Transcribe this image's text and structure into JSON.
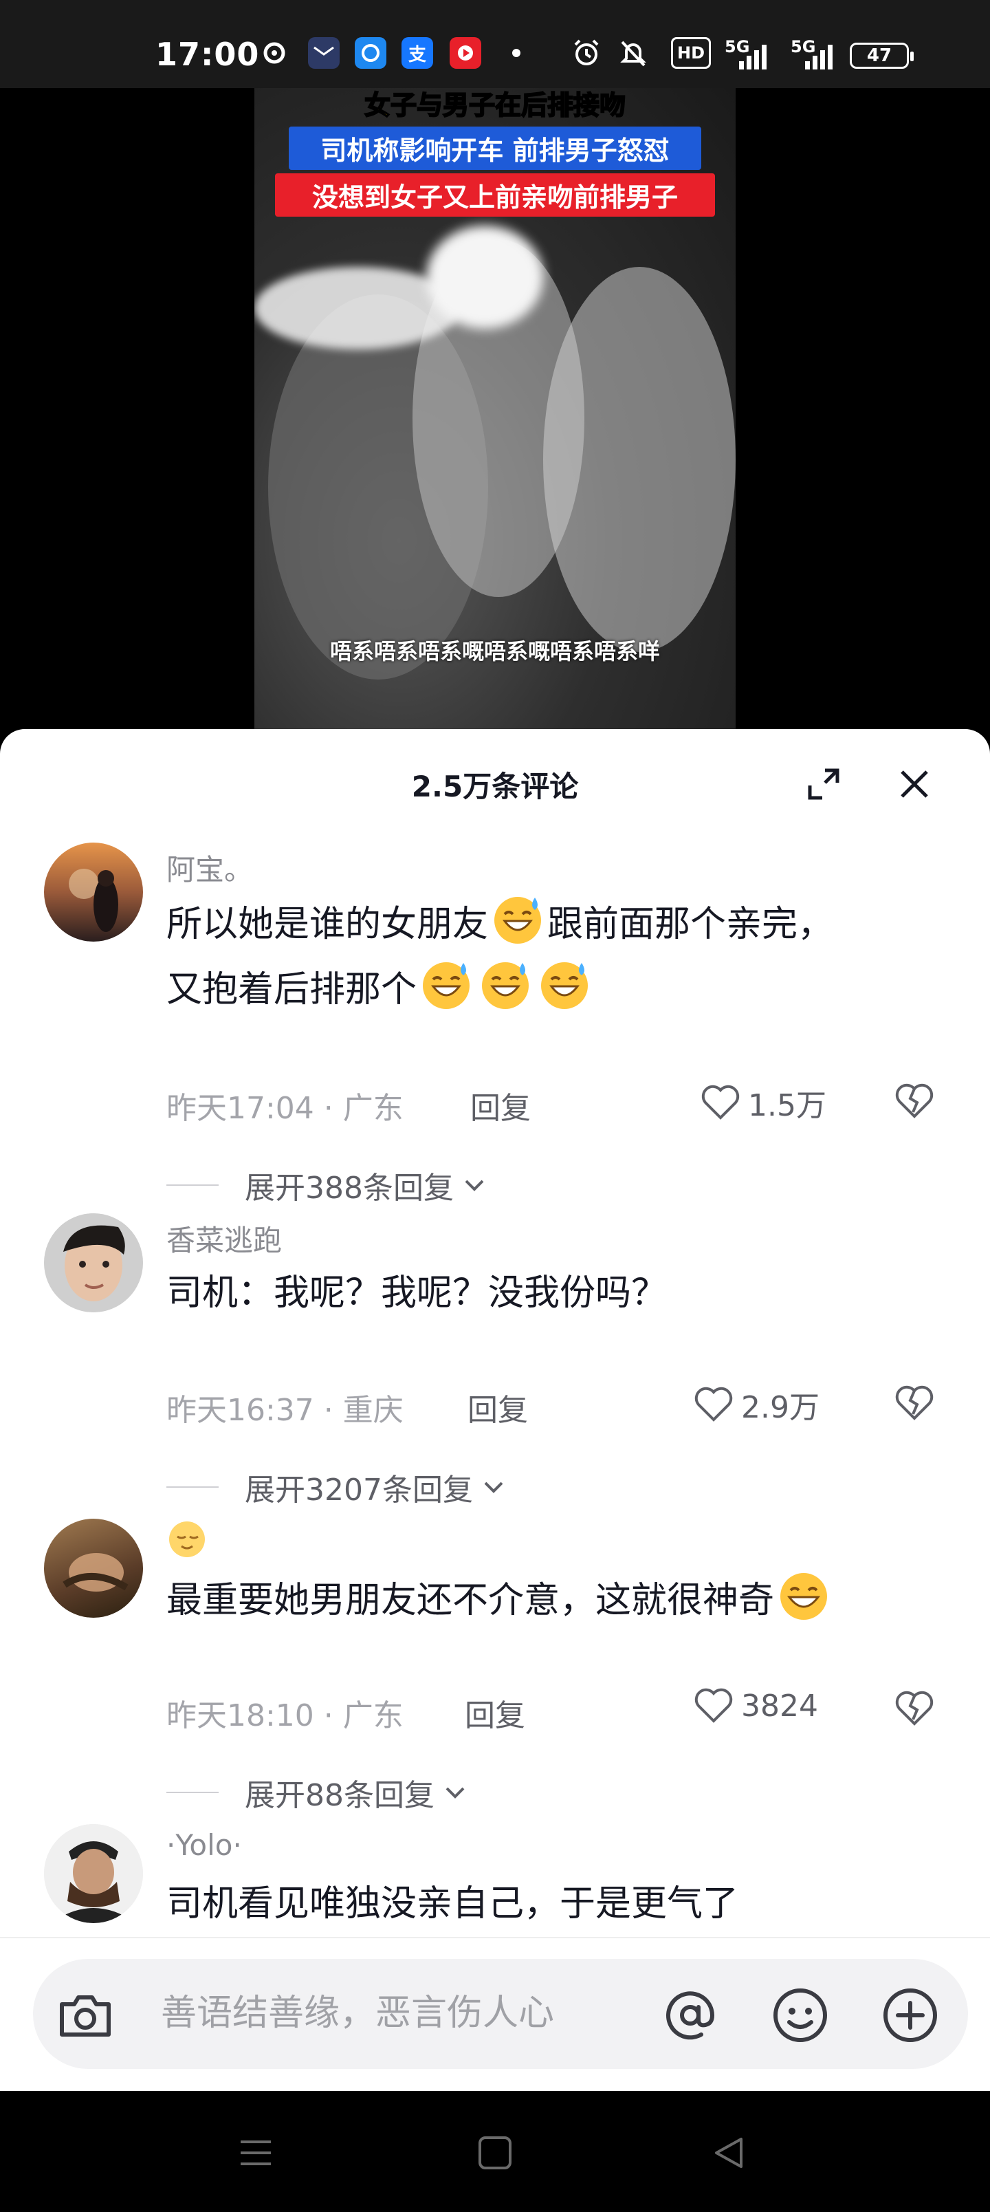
{
  "status_bar": {
    "time": "17:00",
    "hd_label": "HD",
    "net1": "5G",
    "net2": "5G",
    "battery": "47"
  },
  "video": {
    "headline_1": "女子与男子在后排接吻",
    "headline_2": "司机称影响开车 前排男子怒怼",
    "headline_3": "没想到女子又上前亲吻前排男子",
    "caption": "唔系唔系唔系嘅唔系嘅唔系唔系咩"
  },
  "sheet": {
    "title": "2.5万条评论",
    "input_placeholder": "善语结善缘，恶言伤人心"
  },
  "comments": [
    {
      "user": "阿宝。",
      "text_a": "所以她是谁的女朋友",
      "text_b": "跟前面那个亲完，",
      "text_c": "又抱着后排那个",
      "meta": "昨天17:04 · 广东",
      "reply": "回复",
      "likes": "1.5万",
      "expand": "展开388条回复"
    },
    {
      "user": "香菜逃跑",
      "text": "司机：我呢？我呢？没我份吗？",
      "meta": "昨天16:37 · 重庆",
      "reply": "回复",
      "likes": "2.9万",
      "expand": "展开3207条回复"
    },
    {
      "user": "",
      "text": "最重要她男朋友还不介意，这就很神奇",
      "meta": "昨天18:10 · 广东",
      "reply": "回复",
      "likes": "3824",
      "expand": "展开88条回复"
    },
    {
      "user": "·Yolo·",
      "text": "司机看见唯独没亲自己，于是更气了"
    }
  ],
  "icons": {
    "status": [
      "douyin-icon",
      "mail-icon",
      "browser-icon",
      "alipay-icon",
      "video-app-icon",
      "alarm-icon",
      "mute-icon",
      "signal-icon",
      "battery-icon"
    ],
    "sheet": [
      "expand-icon",
      "close-icon",
      "heart-icon",
      "broken-heart-icon",
      "chevron-down-icon",
      "sweat-smile-emoji",
      "grin-emoji",
      "relieved-emoji"
    ],
    "input": [
      "camera-icon",
      "at-icon",
      "smiley-icon",
      "plus-icon"
    ],
    "nav": [
      "menu-icon",
      "home-icon",
      "back-icon"
    ]
  },
  "colors": {
    "text_primary": "#161823",
    "text_secondary": "#8a8b91",
    "headline_yellow": "#ffd200",
    "headline_blue": "#1e5bd8",
    "headline_red": "#e8202a"
  }
}
